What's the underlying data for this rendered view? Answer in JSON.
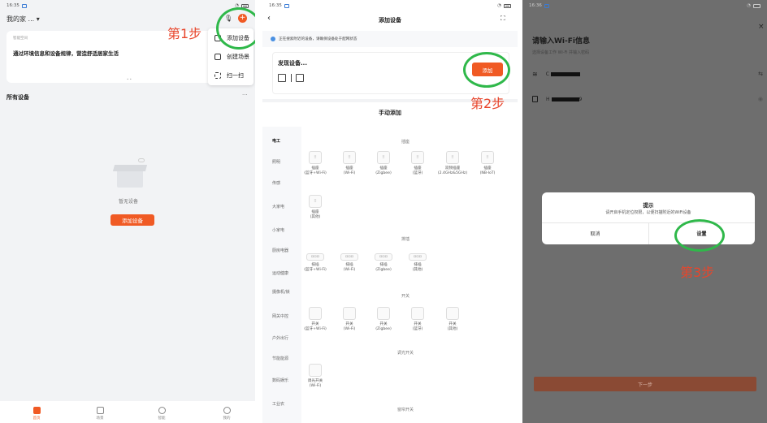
{
  "panel1": {
    "status": {
      "time": "16:35"
    },
    "home_name": "我的家 ...",
    "banner": {
      "small_label": "智能空间",
      "text": "通过环境信息和设备规律，营造舒适居家生活"
    },
    "menu": [
      {
        "label": "添加设备",
        "icon": "plus-device-icon"
      },
      {
        "label": "创建场景",
        "icon": "scene-icon"
      },
      {
        "label": "扫一扫",
        "icon": "scan-icon"
      }
    ],
    "section_title": "所有设备",
    "more": "···",
    "empty_text": "暂无设备",
    "add_button": "添加设备",
    "tabs": [
      {
        "label": "首页",
        "icon": "home-icon",
        "active": true
      },
      {
        "label": "场景",
        "icon": "scene-check-icon",
        "active": false
      },
      {
        "label": "智能",
        "icon": "smart-icon",
        "active": false
      },
      {
        "label": "我的",
        "icon": "profile-icon",
        "active": false
      }
    ],
    "annotation": "第1步"
  },
  "panel2": {
    "status": {
      "time": "16:35"
    },
    "title": "添加设备",
    "notice": "正在搜索附近的设备，请确保设备处于配网状态",
    "notice_link": "配网状态",
    "discover_title": "发现设备...",
    "add_button": "添加",
    "manual_title": "手动添加",
    "categories": [
      "电工",
      "照明",
      "传感",
      "大家电",
      "小家电",
      "厨房电器",
      "运动健康",
      "摄像机/锁",
      "网关中控",
      "户外出行",
      "节能能源",
      "数码娱乐",
      "工业农"
    ],
    "sections": {
      "plug": "插座",
      "strip": "排插",
      "switch": "开关",
      "dimmer": "调光开关",
      "curtain": "窗帘开关"
    },
    "plugs": [
      {
        "name": "插座",
        "sub": "(蓝牙+Wi-Fi)"
      },
      {
        "name": "插座",
        "sub": "(Wi-Fi)"
      },
      {
        "name": "插座",
        "sub": "(Zigbee)"
      },
      {
        "name": "插座",
        "sub": "(蓝牙)"
      },
      {
        "name": "双频插座",
        "sub": "(2.4GHz&5GHz)"
      },
      {
        "name": "插座",
        "sub": "(NB-IoT)"
      },
      {
        "name": "插座",
        "sub": "(其他)"
      }
    ],
    "strips": [
      {
        "name": "排插",
        "sub": "(蓝牙+Wi-Fi)"
      },
      {
        "name": "排插",
        "sub": "(Wi-Fi)"
      },
      {
        "name": "排插",
        "sub": "(Zigbee)"
      },
      {
        "name": "排插",
        "sub": "(其他)"
      }
    ],
    "switches": [
      {
        "name": "开关",
        "sub": "(蓝牙+Wi-Fi)"
      },
      {
        "name": "开关",
        "sub": "(Wi-Fi)"
      },
      {
        "name": "开关",
        "sub": "(Zigbee)"
      },
      {
        "name": "开关",
        "sub": "(蓝牙)"
      },
      {
        "name": "开关",
        "sub": "(其他)"
      }
    ],
    "dimmers": [
      {
        "name": "调光开关",
        "sub": "(Wi-Fi)"
      }
    ],
    "annotation": "第2步"
  },
  "panel3": {
    "status": {
      "time": "16:36"
    },
    "title": "请输入Wi-Fi信息",
    "subtitle": "选择设备工作 Wi-Fi 并输入密码",
    "wifi_name": "C",
    "password": "H",
    "password_tail": "9",
    "dialog": {
      "title": "提示",
      "message": "请开启手机定位权限，以便扫描附近的WiFi设备",
      "cancel": "取消",
      "confirm": "设置"
    },
    "next_button": "下一步",
    "annotation": "第3步"
  },
  "colors": {
    "accent": "#f05a24",
    "annotation": "#e8452b",
    "ring": "#2fb84a"
  }
}
